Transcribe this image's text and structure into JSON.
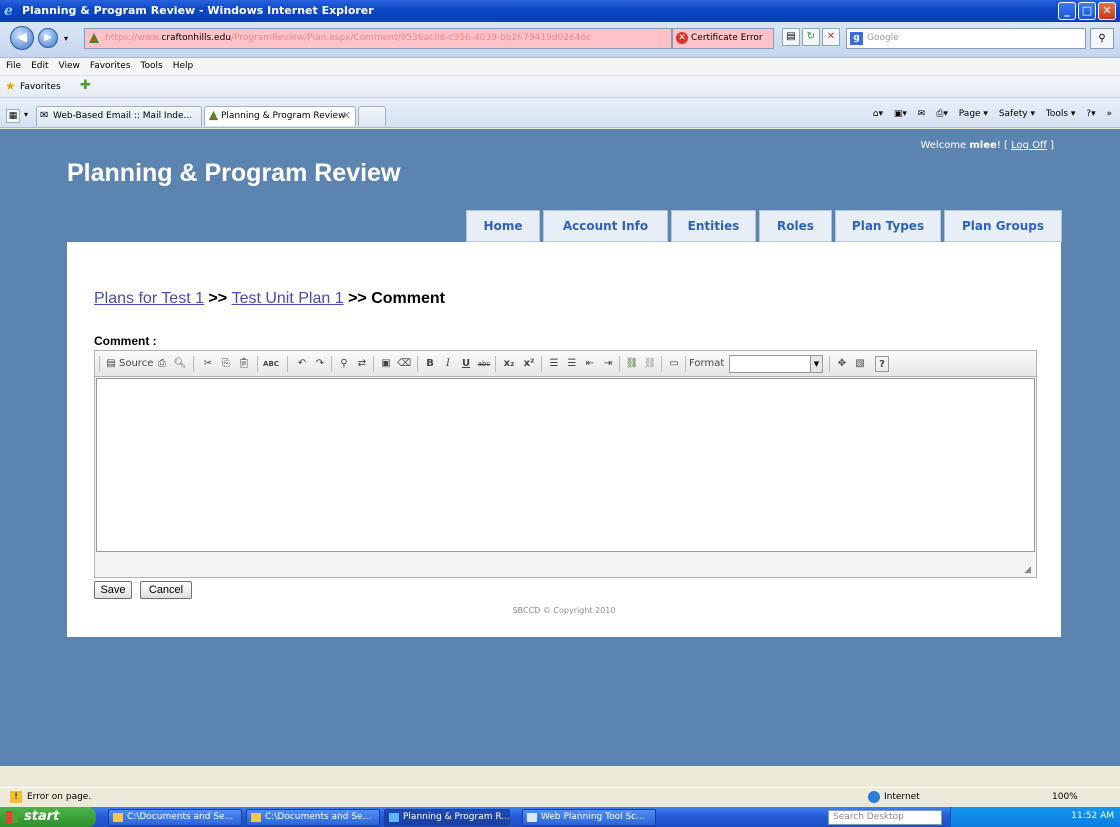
{
  "window": {
    "title": "Planning & Program Review - Windows Internet Explorer"
  },
  "address_bar": {
    "url_prefix": "https://www.",
    "url_host": "craftonhills.edu",
    "url_path": "/ProgramReview/Plan.aspx/Comment/9536ac08-c356-4039-bb2f-79419d02646c",
    "cert_label": "Certificate Error",
    "search_placeholder": "Google"
  },
  "menu": [
    "File",
    "Edit",
    "View",
    "Favorites",
    "Tools",
    "Help"
  ],
  "favorites_bar": {
    "label": "Favorites"
  },
  "tabs": [
    {
      "label": "Web-Based Email :: Mail Inde..."
    },
    {
      "label": "Planning & Program Review"
    }
  ],
  "tab_tools": [
    "Page ▾",
    "Safety ▾",
    "Tools ▾"
  ],
  "page": {
    "welcome_prefix": "Welcome ",
    "username": "mlee",
    "welcome_mid": "! [ ",
    "logoff": "Log Off",
    "welcome_suffix": " ]",
    "site_title": "Planning & Program Review",
    "nav": [
      "Home",
      "Account Info",
      "Entities",
      "Roles",
      "Plan Types",
      "Plan Groups"
    ],
    "breadcrumb": {
      "link1": "Plans for Test 1",
      "sep1": " >> ",
      "link2": "Test Unit Plan 1",
      "sep2": " >> ",
      "current": "Comment"
    },
    "comment_label": "Comment :",
    "editor": {
      "source_label": "Source",
      "format_label": "Format",
      "content": ""
    },
    "save_label": "Save",
    "cancel_label": "Cancel",
    "copyright": "SBCCD © Copyright 2010"
  },
  "status_bar": {
    "text": "Error on page.",
    "zone": "Internet",
    "zoom": "100%"
  },
  "taskbar": {
    "start": "start",
    "tasks": [
      "C:\\Documents and Se...",
      "C:\\Documents and Se...",
      "Planning & Program R...",
      "Web Planning Tool Sc..."
    ],
    "search_placeholder": "Search Desktop",
    "clock": "11:52 AM"
  }
}
